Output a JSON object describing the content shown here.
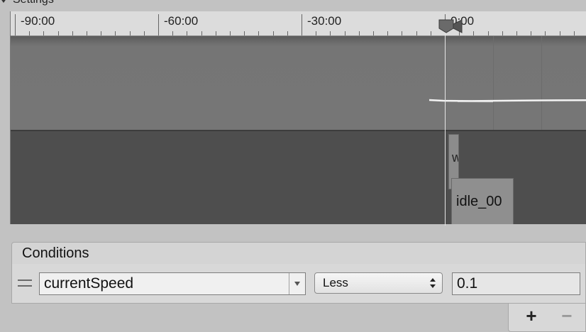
{
  "settings": {
    "label": "Settings"
  },
  "timeline": {
    "ruler_labels": [
      "-90:00",
      "-60:00",
      "-30:00",
      "0:00"
    ],
    "clips": {
      "previous": "w",
      "next": "idle_00"
    }
  },
  "conditions": {
    "header": "Conditions",
    "row": {
      "parameter": "currentSpeed",
      "mode": "Less",
      "value": "0.1"
    },
    "add_label": "+",
    "remove_label": "−"
  },
  "icons": {
    "drag": "drag-handle-icon",
    "dropdown": "chevron-down-icon",
    "updown": "updown-arrows-icon",
    "playhead": "playhead-icon"
  },
  "colors": {
    "ruler": "#dcdcdc",
    "track_top": "#767676",
    "track_bottom": "#4e4e4e",
    "clip": "#8f8f8f",
    "panel": "#d8d8d8"
  }
}
